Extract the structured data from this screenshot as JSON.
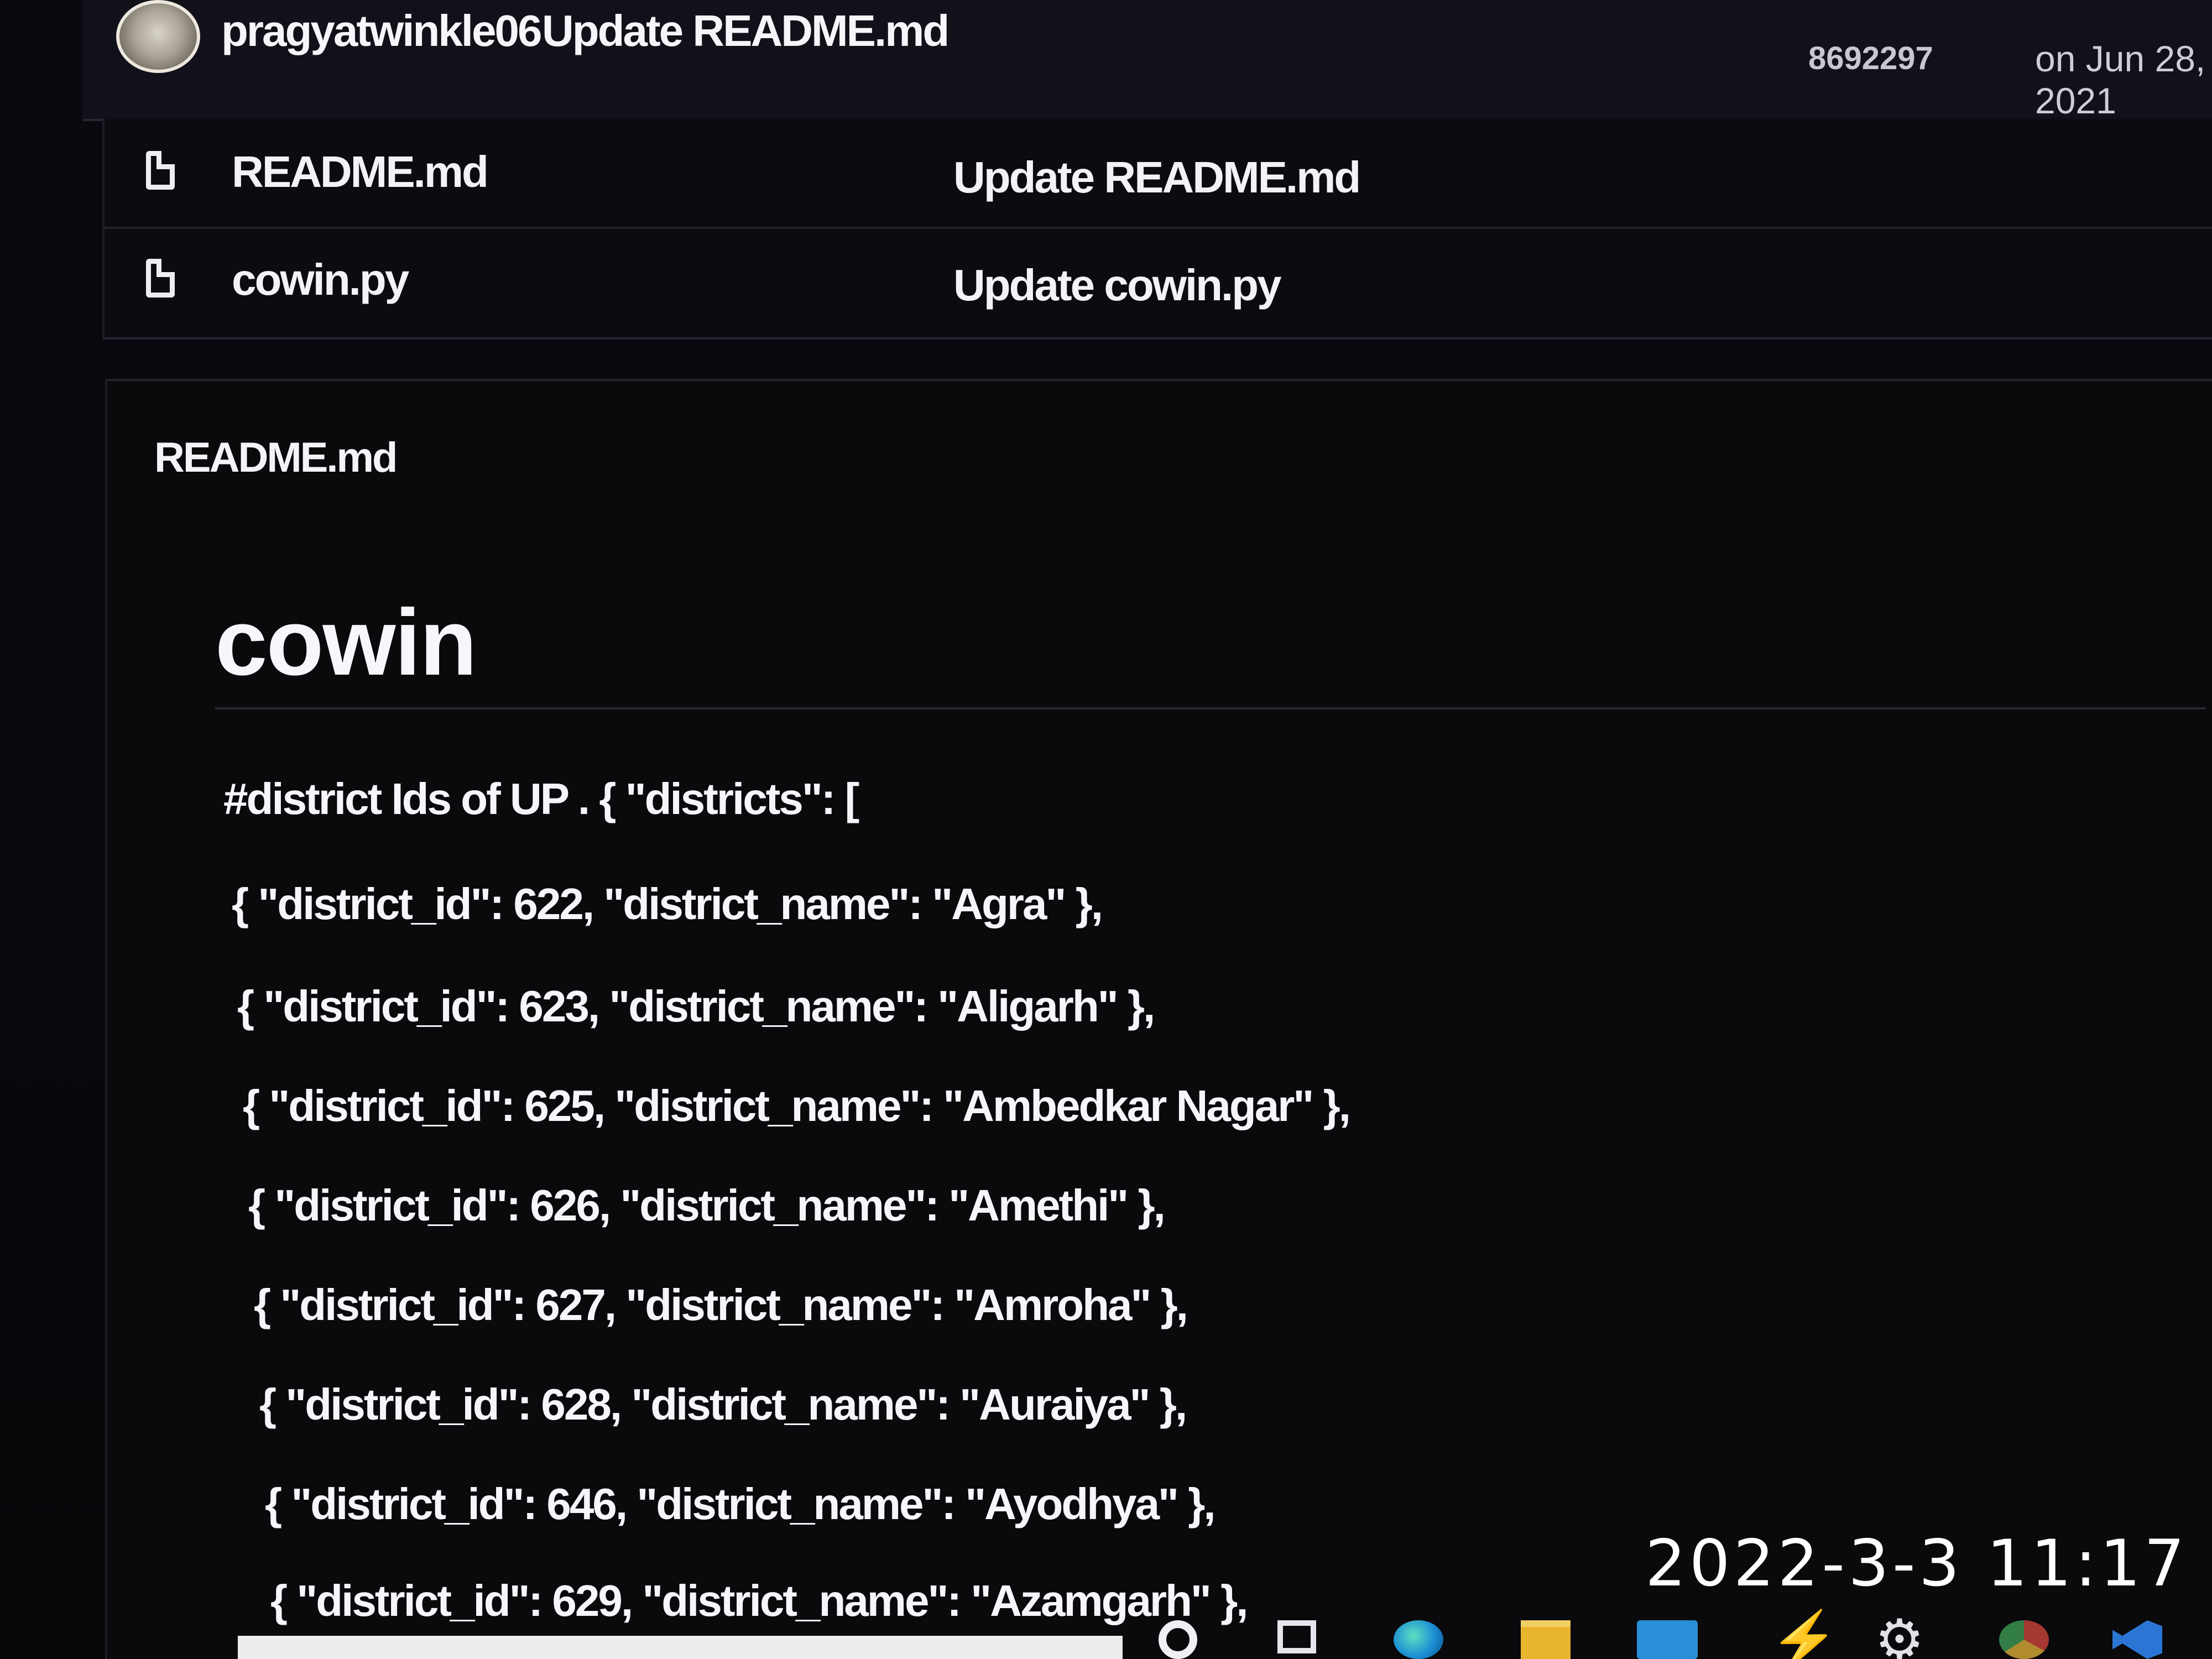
{
  "commit": {
    "author": "pragyatwinkle06",
    "message": "Update README.md",
    "sha": "8692297",
    "date": "on Jun 28, 2021"
  },
  "files": [
    {
      "name": "README.md",
      "last_commit": "Update README.md",
      "icon": "file-icon"
    },
    {
      "name": "cowin.py",
      "last_commit": "Update cowin.py",
      "icon": "file-icon"
    }
  ],
  "readme": {
    "header": "README.md",
    "title": "cowin",
    "lines": [
      "#district Ids of UP . { \"districts\": [",
      "{ \"district_id\": 622, \"district_name\": \"Agra\" },",
      "{ \"district_id\": 623, \"district_name\": \"Aligarh\" },",
      "{ \"district_id\": 625, \"district_name\": \"Ambedkar Nagar\" },",
      "{ \"district_id\": 626, \"district_name\": \"Amethi\" },",
      "{ \"district_id\": 627, \"district_name\": \"Amroha\" },",
      "{ \"district_id\": 628, \"district_name\": \"Auraiya\" },",
      "{ \"district_id\": 646, \"district_name\": \"Ayodhya\" },",
      "{ \"district_id\": 629, \"district_name\": \"Azamgarh\" },"
    ]
  },
  "taskbar": {
    "icons": [
      "search-icon",
      "task-view-icon",
      "edge-icon",
      "file-explorer-icon",
      "mail-icon",
      "bolt-app-icon",
      "settings-gear-icon",
      "chrome-icon",
      "vscode-icon"
    ]
  },
  "photo_timestamp": "2022-3-3 11:17"
}
